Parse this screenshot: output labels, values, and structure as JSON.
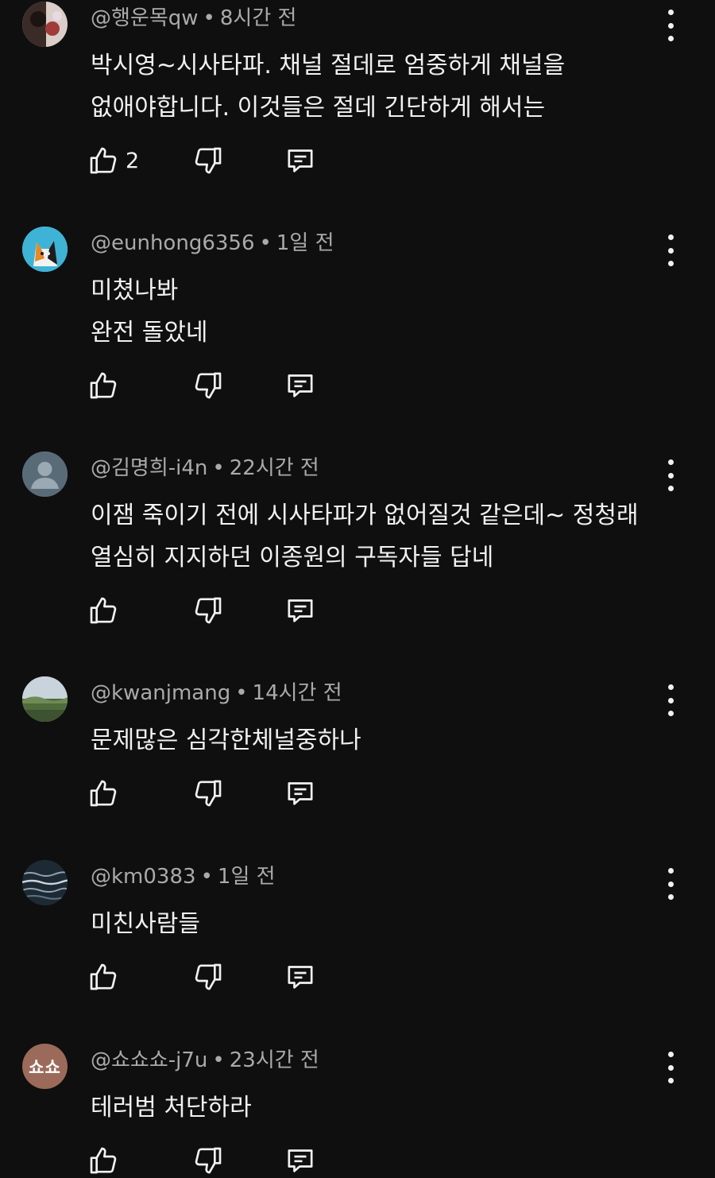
{
  "comments": [
    {
      "author": "@행운목qw",
      "time": "8시간 전",
      "lines": [
        "박시영~시사타파. 채널 절데로 엄중하게 채널을",
        "없애야합니다. 이것들은  절데 긴단하게 해서는"
      ],
      "likes": "2",
      "avatar": {
        "kind": "photo",
        "colors": [
          "#3a2b26",
          "#d9cfc8",
          "#a23a3a"
        ]
      }
    },
    {
      "author": "@eunhong6356",
      "time": "1일 전",
      "lines": [
        "미쳤나봐",
        "완전 돌았네"
      ],
      "likes": "",
      "avatar": {
        "kind": "cat",
        "colors": [
          "#3fb3d6",
          "#e58a2a",
          "#1d1d1d"
        ]
      }
    },
    {
      "author": "@김명희-i4n",
      "time": "22시간 전",
      "lines": [
        "이잼 죽이기 전에 시사타파가 없어질것 같은데~ 정청래",
        "열심히 지지하던 이종원의 구독자들 답네"
      ],
      "likes": "",
      "avatar": {
        "kind": "default",
        "colors": [
          "#5a6b78",
          "#9aa9b4"
        ]
      }
    },
    {
      "author": "@kwanjmang",
      "time": "14시간 전",
      "lines": [
        "문제많은 심각한체널중하나"
      ],
      "likes": "",
      "avatar": {
        "kind": "landscape",
        "colors": [
          "#c9d3dc",
          "#4f6b3c",
          "#6f8a55"
        ]
      }
    },
    {
      "author": "@km0383",
      "time": "1일 전",
      "lines": [
        "미친사람들"
      ],
      "likes": "",
      "avatar": {
        "kind": "water",
        "colors": [
          "#1e2a33",
          "#8fa3b1",
          "#c9d6de"
        ]
      }
    },
    {
      "author": "@쇼쇼쇼-j7u",
      "time": "23시간 전",
      "lines": [
        "테러범 처단하라"
      ],
      "likes": "",
      "avatar": {
        "kind": "initials",
        "text": "쇼쇼",
        "colors": [
          "#9c6a5a"
        ]
      }
    }
  ],
  "separator": "•",
  "icons": {
    "like": "thumbs-up-icon",
    "dislike": "thumbs-down-icon",
    "reply": "reply-comment-icon",
    "more": "more-vert-icon"
  }
}
